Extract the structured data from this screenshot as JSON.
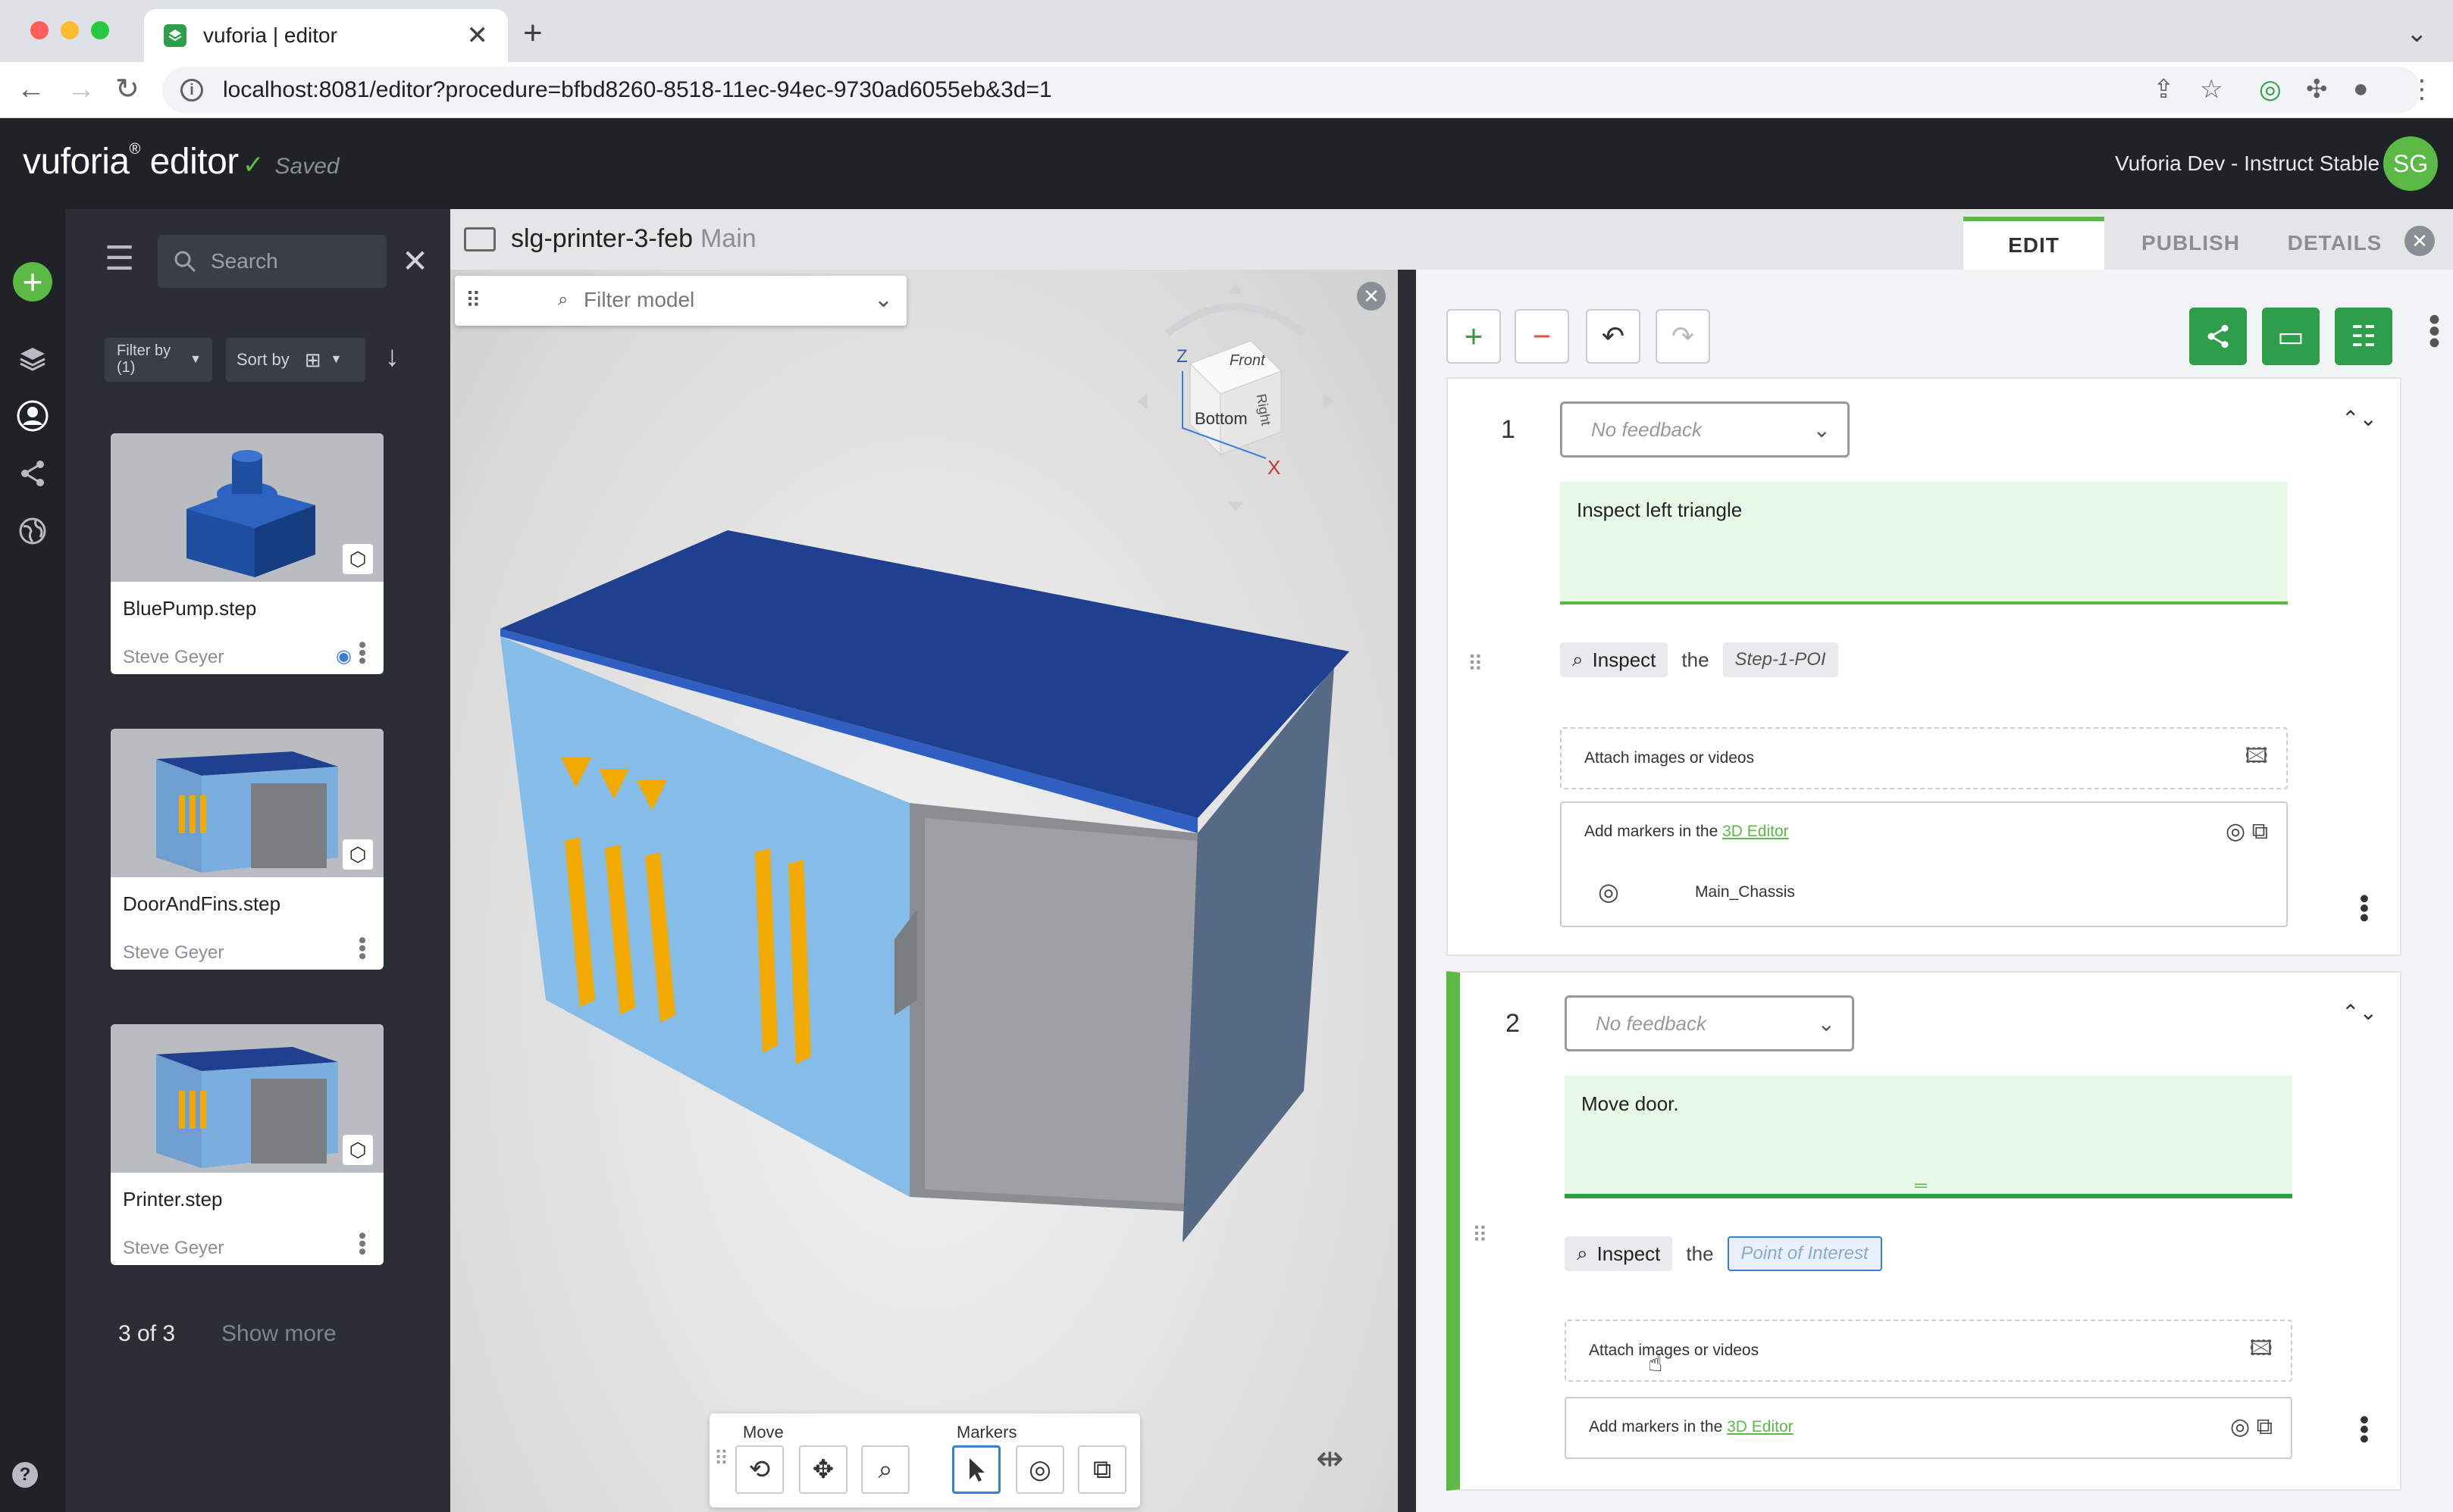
{
  "browser": {
    "tab_title": "vuforia | editor",
    "url": "localhost:8081/editor?procedure=bfbd8260-8518-11ec-94ec-9730ad6055eb&3d=1"
  },
  "app": {
    "logo": "vuforia",
    "logo_sup": "®",
    "logo_suffix": "editor",
    "status": "Saved",
    "org": "Vuforia Dev - Instruct Stable",
    "avatar_initials": "SG"
  },
  "library": {
    "search_placeholder": "Search",
    "filter_label": "Filter by (1)",
    "sort_label": "Sort by",
    "items": [
      {
        "name": "BluePump.step",
        "owner": "Steve Geyer"
      },
      {
        "name": "DoorAndFins.step",
        "owner": "Steve Geyer"
      },
      {
        "name": "Printer.step",
        "owner": "Steve Geyer"
      }
    ],
    "count": "3 of 3",
    "show_more": "Show more"
  },
  "viewport": {
    "title": "slg-printer-3-feb",
    "subtitle": "Main",
    "filter_placeholder": "Filter model",
    "cube_labels": {
      "front": "Front",
      "bottom": "Bottom",
      "right": "Right",
      "z": "Z",
      "x": "X"
    },
    "toolbar": {
      "move_label": "Move",
      "markers_label": "Markers"
    }
  },
  "panel": {
    "tabs": [
      "EDIT",
      "PUBLISH",
      "DETAILS"
    ],
    "active_tab": "EDIT",
    "steps": [
      {
        "number": "1",
        "feedback": "No feedback",
        "instruction": "Inspect left triangle",
        "action": "Inspect",
        "connector": "the",
        "target": "Step-1-POI",
        "attach_label": "Attach images or videos",
        "markers_prefix": "Add markers in the",
        "markers_link": "3D Editor",
        "marker_item": "Main_Chassis"
      },
      {
        "number": "2",
        "feedback": "No feedback",
        "instruction": "Move door.",
        "action": "Inspect",
        "connector": "the",
        "target": "Point of Interest",
        "attach_label": "Attach images or videos",
        "markers_prefix": "Add markers in the",
        "markers_link": "3D Editor"
      }
    ]
  },
  "colors": {
    "brand_green": "#5bb946",
    "dark_header": "#1f2226",
    "cabinet_blue": "#1f3f8f",
    "fin_orange": "#f2a900"
  }
}
